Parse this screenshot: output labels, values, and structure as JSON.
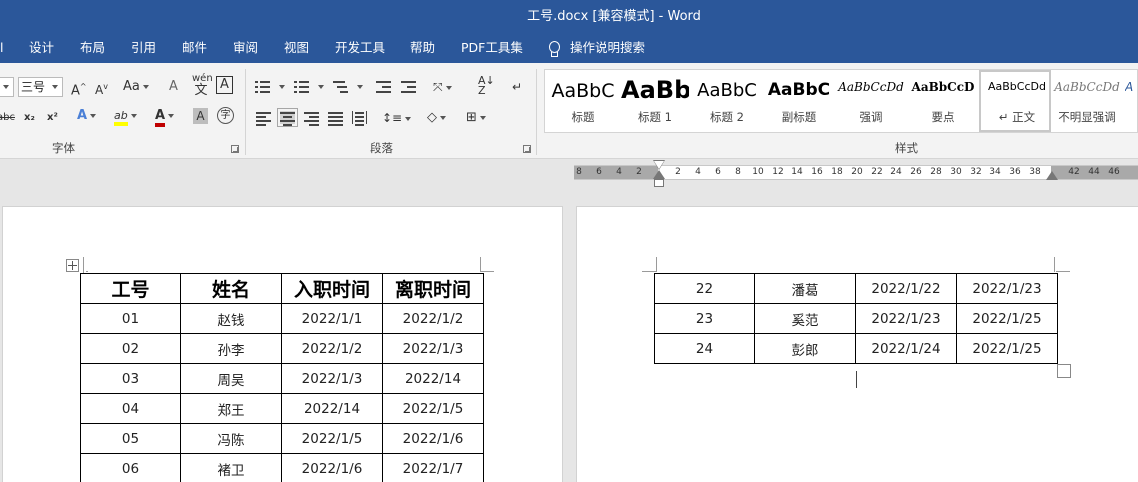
{
  "window": {
    "title": "工号.docx [兼容模式]  -  Word"
  },
  "menu": {
    "tabs": [
      "设计",
      "布局",
      "引用",
      "邮件",
      "审阅",
      "视图",
      "开发工具",
      "帮助",
      "PDF工具集"
    ],
    "tell_me": "操作说明搜索"
  },
  "ribbon": {
    "font_group": {
      "label": "字体",
      "font_size": "三号",
      "grow_font": "A",
      "shrink_font": "A",
      "change_case": "Aa",
      "phonetic": "wén",
      "char_border": "A",
      "strikethrough": "abc",
      "subscript": "x₂",
      "superscript": "x²",
      "text_effect": "A",
      "highlight": "ab",
      "font_color": "A",
      "char_shading": "A",
      "enclose_char": "字"
    },
    "paragraph_group": {
      "label": "段落"
    },
    "styles_group": {
      "label": "样式",
      "items": [
        {
          "sample": "AaBbC",
          "name": "标题"
        },
        {
          "sample": "AaBb",
          "name": "标题 1"
        },
        {
          "sample": "AaBbC",
          "name": "标题 2"
        },
        {
          "sample": "AaBbC",
          "name": "副标题"
        },
        {
          "sample": "AaBbCcDd",
          "name": "强调"
        },
        {
          "sample": "AaBbCcD",
          "name": "要点"
        },
        {
          "sample": "AaBbCcDd",
          "name": "正文",
          "selected": true
        },
        {
          "sample": "AaBbCcDd",
          "name": "不明显强调"
        },
        {
          "sample": "A",
          "name": ""
        }
      ]
    }
  },
  "ruler": {
    "left_numbers": [
      "8",
      "6",
      "4",
      "2"
    ],
    "numbers": [
      "2",
      "4",
      "6",
      "8",
      "10",
      "12",
      "14",
      "16",
      "18",
      "20",
      "22",
      "24",
      "26",
      "28",
      "30",
      "32",
      "34",
      "36",
      "38"
    ],
    "right_numbers": [
      "42",
      "44",
      "46"
    ]
  },
  "table_left": {
    "headers": [
      "工号",
      "姓名",
      "入职时间",
      "离职时间"
    ],
    "rows": [
      [
        "01",
        "赵钱",
        "2022/1/1",
        "2022/1/2"
      ],
      [
        "02",
        "孙李",
        "2022/1/2",
        "2022/1/3"
      ],
      [
        "03",
        "周吴",
        "2022/1/3",
        "2022/14"
      ],
      [
        "04",
        "郑王",
        "2022/14",
        "2022/1/5"
      ],
      [
        "05",
        "冯陈",
        "2022/1/5",
        "2022/1/6"
      ],
      [
        "06",
        "褚卫",
        "2022/1/6",
        "2022/1/7"
      ]
    ]
  },
  "table_right": {
    "rows": [
      [
        "22",
        "潘葛",
        "2022/1/22",
        "2022/1/23"
      ],
      [
        "23",
        "奚范",
        "2022/1/23",
        "2022/1/25"
      ],
      [
        "24",
        "彭郎",
        "2022/1/24",
        "2022/1/25"
      ]
    ]
  }
}
